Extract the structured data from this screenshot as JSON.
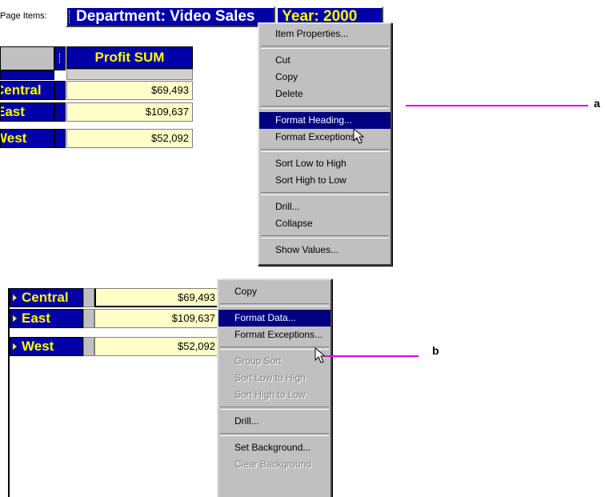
{
  "top": {
    "page_items_label": "Page Items:",
    "department_item": "Department: Video Sales",
    "year_item": "Year: 2000",
    "profit_header": "Profit SUM",
    "rows": [
      {
        "label": "Central",
        "value": "$69,493"
      },
      {
        "label": "East",
        "value": "$109,637"
      },
      {
        "label": "West",
        "value": "$52,092"
      }
    ],
    "menu": {
      "groups": [
        [
          "Item Properties..."
        ],
        [
          "Cut",
          "Copy",
          "Delete"
        ],
        [
          "Format Heading...",
          "Format Exceptions..."
        ],
        [
          "Sort Low to High",
          "Sort High to Low"
        ],
        [
          "Drill...",
          "Collapse"
        ],
        [
          "Show Values..."
        ]
      ],
      "selected": "Format Heading..."
    },
    "callout": "a"
  },
  "bottom": {
    "rows": [
      {
        "label": "Central",
        "value": "$69,493"
      },
      {
        "label": "East",
        "value": "$109,637"
      },
      {
        "label": "West",
        "value": "$52,092"
      }
    ],
    "menu": {
      "groups": [
        [
          "Copy"
        ],
        [
          "Format Data...",
          "Format Exceptions..."
        ],
        [
          "Group Sort",
          "Sort Low to High",
          "Sort High to Low"
        ],
        [
          "Drill..."
        ],
        [
          "Set Background...",
          "Clear Background"
        ]
      ],
      "selected": "Format Data...",
      "disabled": [
        "Group Sort",
        "Sort Low to High",
        "Sort High to Low",
        "Clear Background"
      ]
    },
    "callout": "b"
  },
  "colors": {
    "header_blue": "#0000a8",
    "header_text": "#ffff00",
    "cell_fill": "#ffffc8",
    "menu_bg": "#c0c0c0",
    "selection": "#000080",
    "callout_line": "#e000e0"
  }
}
